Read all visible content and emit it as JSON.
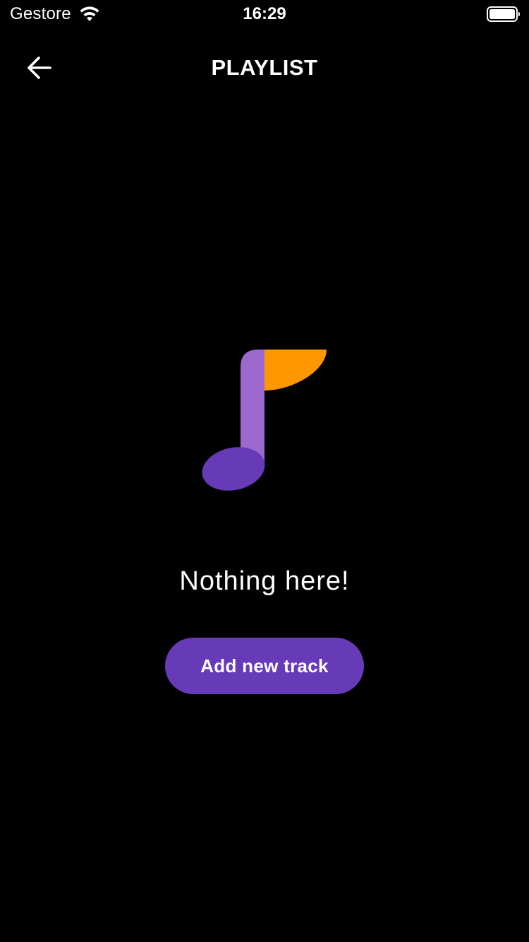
{
  "status_bar": {
    "carrier": "Gestore",
    "time": "16:29",
    "wifi_icon": "wifi-icon",
    "battery_icon": "battery-icon",
    "battery_level": 1.0
  },
  "header": {
    "back_icon": "arrow-left-icon",
    "title": "PLAYLIST"
  },
  "empty_state": {
    "illustration_icon": "music-note-icon",
    "message": "Nothing here!",
    "button_label": "Add new track"
  },
  "colors": {
    "background": "#000000",
    "text": "#ffffff",
    "accent": "#673AB7",
    "note_stem": "#9C6ACF",
    "note_head": "#673AB7",
    "note_flag": "#FF9800"
  }
}
